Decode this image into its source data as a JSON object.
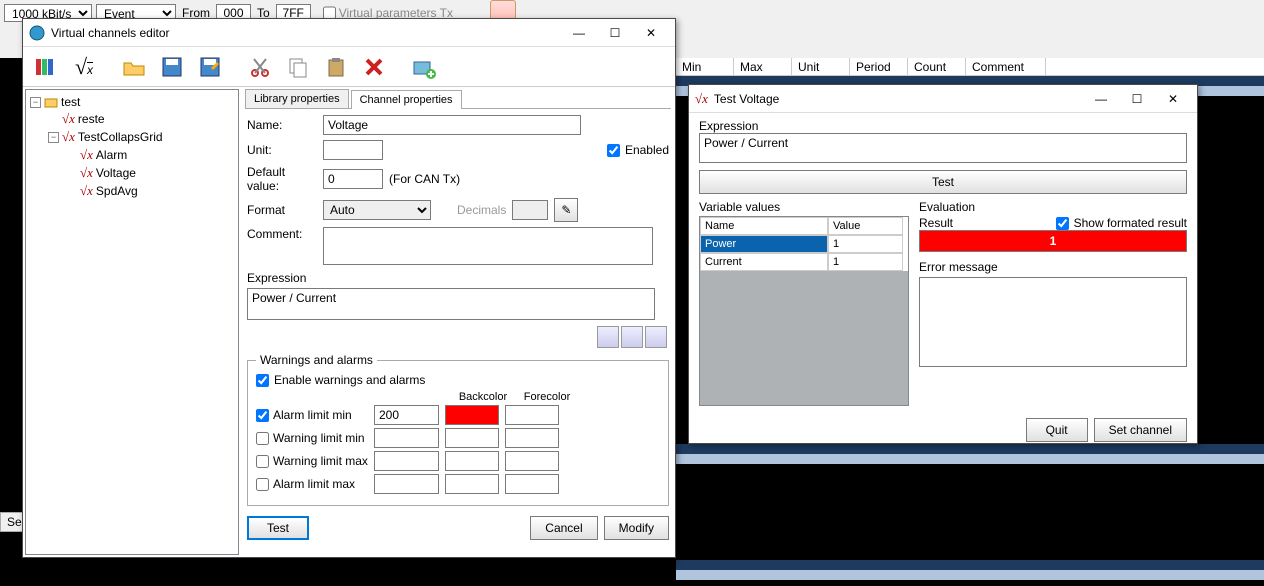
{
  "top": {
    "speed": "1000 kBit/s",
    "mode": "Event",
    "from_lbl": "From",
    "from_val": "000",
    "to_lbl": "To",
    "to_val": "7FF",
    "virt_param_lbl": "Virtual parameters Tx"
  },
  "sen_label": "Sen",
  "header_cols": [
    "Min",
    "Max",
    "Unit",
    "Period",
    "Count",
    "Comment"
  ],
  "editor": {
    "title": "Virtual channels editor",
    "tree": {
      "root": "test",
      "children": [
        {
          "n": "reste",
          "leaf": true
        },
        {
          "n": "TestCollapsGrid",
          "leaf": false,
          "children": [
            "Alarm",
            "Voltage",
            "SpdAvg"
          ]
        }
      ]
    },
    "tabs": {
      "lib": "Library properties",
      "chan": "Channel properties"
    },
    "form": {
      "name_lbl": "Name:",
      "name_val": "Voltage",
      "unit_lbl": "Unit:",
      "unit_val": "",
      "enabled_lbl": "Enabled",
      "default_lbl": "Default value:",
      "default_val": "0",
      "default_hint": "(For CAN Tx)",
      "format_lbl": "Format",
      "format_val": "Auto",
      "decimals_lbl": "Decimals",
      "comment_lbl": "Comment:",
      "comment_val": "",
      "expr_lbl": "Expression",
      "expr_val": "Power / Current"
    },
    "warnings": {
      "legend": "Warnings and alarms",
      "enable_lbl": "Enable warnings and alarms",
      "backcolor_lbl": "Backcolor",
      "forecolor_lbl": "Forecolor",
      "alarm_min_lbl": "Alarm limit min",
      "alarm_min_val": "200",
      "alarm_min_back": "#ff0000",
      "alarm_min_fore": "#ffffff",
      "warn_min_lbl": "Warning limit min",
      "warn_max_lbl": "Warning limit max",
      "alarm_max_lbl": "Alarm limit max"
    },
    "buttons": {
      "test": "Test",
      "cancel": "Cancel",
      "modify": "Modify"
    }
  },
  "testwin": {
    "title": "Test Voltage",
    "expr_lbl": "Expression",
    "expr_val": "Power / Current",
    "test_btn": "Test",
    "vars_lbl": "Variable values",
    "eval_lbl": "Evaluation",
    "name_col": "Name",
    "value_col": "Value",
    "rows": [
      {
        "name": "Power",
        "value": "1"
      },
      {
        "name": "Current",
        "value": "1"
      }
    ],
    "result_lbl": "Result",
    "show_fmt_lbl": "Show formated result",
    "result_val": "1",
    "err_lbl": "Error message",
    "quit_btn": "Quit",
    "set_btn": "Set channel"
  }
}
